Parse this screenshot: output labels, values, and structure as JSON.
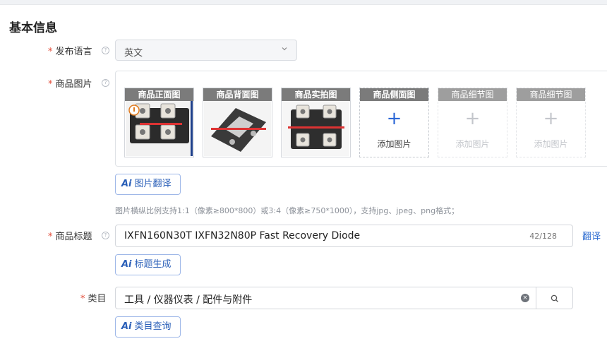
{
  "section": {
    "title": "基本信息"
  },
  "colors": {
    "required_star": "#e34d3a",
    "accent": "#2a66d6",
    "ai_button": "#2a5fb8",
    "caption_bg": "#7b7b7b"
  },
  "fields": {
    "language": {
      "label": "发布语言",
      "required": "*",
      "value": "英文",
      "icon": "chevron-down-icon"
    },
    "images": {
      "label": "商品图片",
      "required": "*",
      "slots": [
        {
          "caption": "商品正面图",
          "filled": true
        },
        {
          "caption": "商品背面图",
          "filled": true
        },
        {
          "caption": "商品实拍图",
          "filled": true
        },
        {
          "caption": "商品侧面图",
          "filled": false,
          "add_text": "添加图片",
          "plus": "+"
        },
        {
          "caption": "商品细节图",
          "filled": false,
          "add_text": "添加图片",
          "plus": "+"
        },
        {
          "caption": "商品细节图",
          "filled": false,
          "add_text": "添加图片",
          "plus": "+"
        }
      ],
      "ai_button": {
        "icon": "Ai",
        "label": "图片翻译"
      },
      "hint": "图片横纵比例支持1:1（像素≥800*800）或3:4（像素≥750*1000），支持jpg、jpeg、png格式；"
    },
    "title": {
      "label": "商品标题",
      "required": "*",
      "value": "IXFN160N30T IXFN32N80P Fast Recovery Diode",
      "count": "42/128",
      "translate_link": "翻译",
      "ai_button": {
        "icon": "Ai",
        "label": "标题生成"
      }
    },
    "category": {
      "label": "类目",
      "required": "*",
      "value": "工具 / 仪器仪表 / 配件与附件",
      "clear_icon": "×",
      "ai_button": {
        "icon": "Ai",
        "label": "类目查询"
      }
    }
  }
}
